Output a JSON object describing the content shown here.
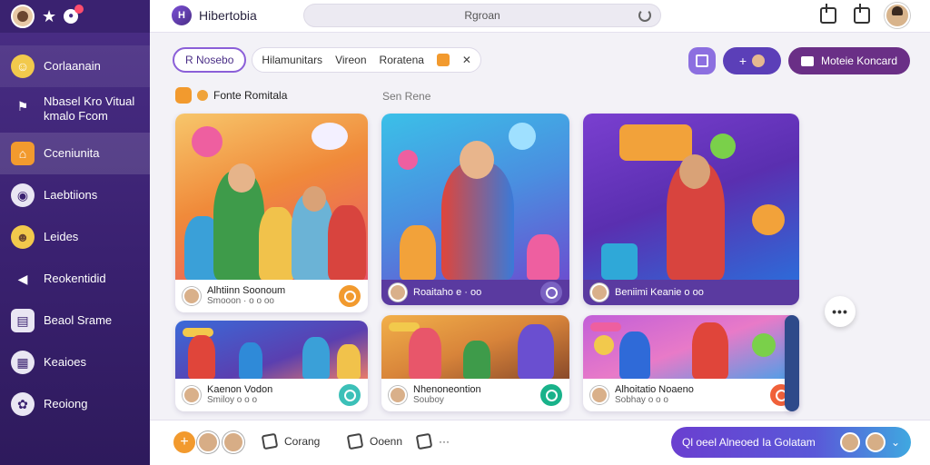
{
  "sidebar": {
    "notification_badge_color": "#ff4d6d",
    "items": [
      {
        "label": "Corlaanain",
        "icon": "user-avatar-icon",
        "color": "#f2c94c"
      },
      {
        "label": "Nbasel Kro Vitual\nkmalo Fcom",
        "icon": "dog-icon",
        "color": "#ffffff"
      },
      {
        "label": "Cceniunita",
        "icon": "house-icon",
        "color": "#f29a2e"
      },
      {
        "label": "Laebtiions",
        "icon": "globe-icon",
        "color": "#ffffff"
      },
      {
        "label": "Leides",
        "icon": "smiley-icon",
        "color": "#f2c94c"
      },
      {
        "label": "Reokentidid",
        "icon": "megaphone-icon",
        "color": "#ffffff"
      },
      {
        "label": "Beaol Srame",
        "icon": "controller-icon",
        "color": "#ffffff"
      },
      {
        "label": "Keaioes",
        "icon": "grid-icon",
        "color": "#ffffff"
      },
      {
        "label": "Reoiong",
        "icon": "settings-icon",
        "color": "#ffffff"
      }
    ]
  },
  "topbar": {
    "app_name": "Hibertobia",
    "logo_letter": "H",
    "search_text": "Rgroan"
  },
  "filters": {
    "selected_chip": "R Nosebo",
    "group_chips": [
      "Hilamunitars",
      "Vireon",
      "Roratena"
    ]
  },
  "actions": {
    "primary_button": "Moteie Koncard"
  },
  "section": {
    "title": "Fonte Romitala",
    "see_more": "Sen Rene"
  },
  "cards": [
    {
      "title": "Alhtiinn Soonoum",
      "sub": "Smooon  ·  o o oo",
      "button_color": "#f29a2e"
    },
    {
      "title": "Roaitaho e  ·  oo",
      "sub": "",
      "button_color": "#7a62c2"
    },
    {
      "title": "Beniimi Keanie o oo",
      "sub": "",
      "button_color": "#5a3aa0"
    },
    {
      "title": "Kaenon Vodon",
      "sub": "Smiloy  o o o",
      "button_color": "#3cc0b8"
    },
    {
      "title": "Nhenoneontion",
      "sub": "Souboy",
      "button_color": "#19b28a"
    },
    {
      "title": "Alhoitatio Noaeno",
      "sub": "Sobhay  o o o",
      "button_color": "#f0613a"
    }
  ],
  "bottombar": {
    "actions": [
      "Corang",
      "Ooenn"
    ],
    "cta_label": "Ql oeel Alneoed Ia Golatam"
  },
  "colors": {
    "accent": "#5b3fb8",
    "sidebar": "#3a2170",
    "orange": "#f29a2e"
  }
}
